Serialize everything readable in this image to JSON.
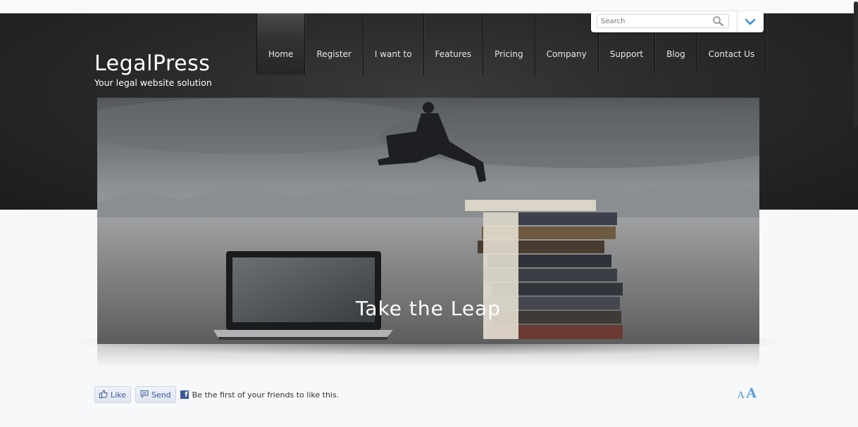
{
  "site": {
    "title": "LegalPress",
    "tagline": "Your legal website solution"
  },
  "nav": {
    "items": [
      {
        "label": "Home",
        "active": true
      },
      {
        "label": "Register",
        "active": false
      },
      {
        "label": "I want to",
        "active": false
      },
      {
        "label": "Features",
        "active": false
      },
      {
        "label": "Pricing",
        "active": false
      },
      {
        "label": "Company",
        "active": false
      },
      {
        "label": "Support",
        "active": false
      },
      {
        "label": "Blog",
        "active": false
      },
      {
        "label": "Contact Us",
        "active": false
      }
    ]
  },
  "search": {
    "placeholder": "Search",
    "icon": "magnifier-icon",
    "dropdown_icon": "chevron-down-icon"
  },
  "banner": {
    "caption": "Take the Leap"
  },
  "social": {
    "like_label": "Like",
    "send_label": "Send",
    "fb_text": "Be the first of your friends to like this."
  },
  "font_controls": {
    "small": "A",
    "large": "A"
  },
  "colors": {
    "header_bg": "#262626",
    "accent_blue": "#4a8fd4",
    "facebook_blue": "#3b5998"
  }
}
